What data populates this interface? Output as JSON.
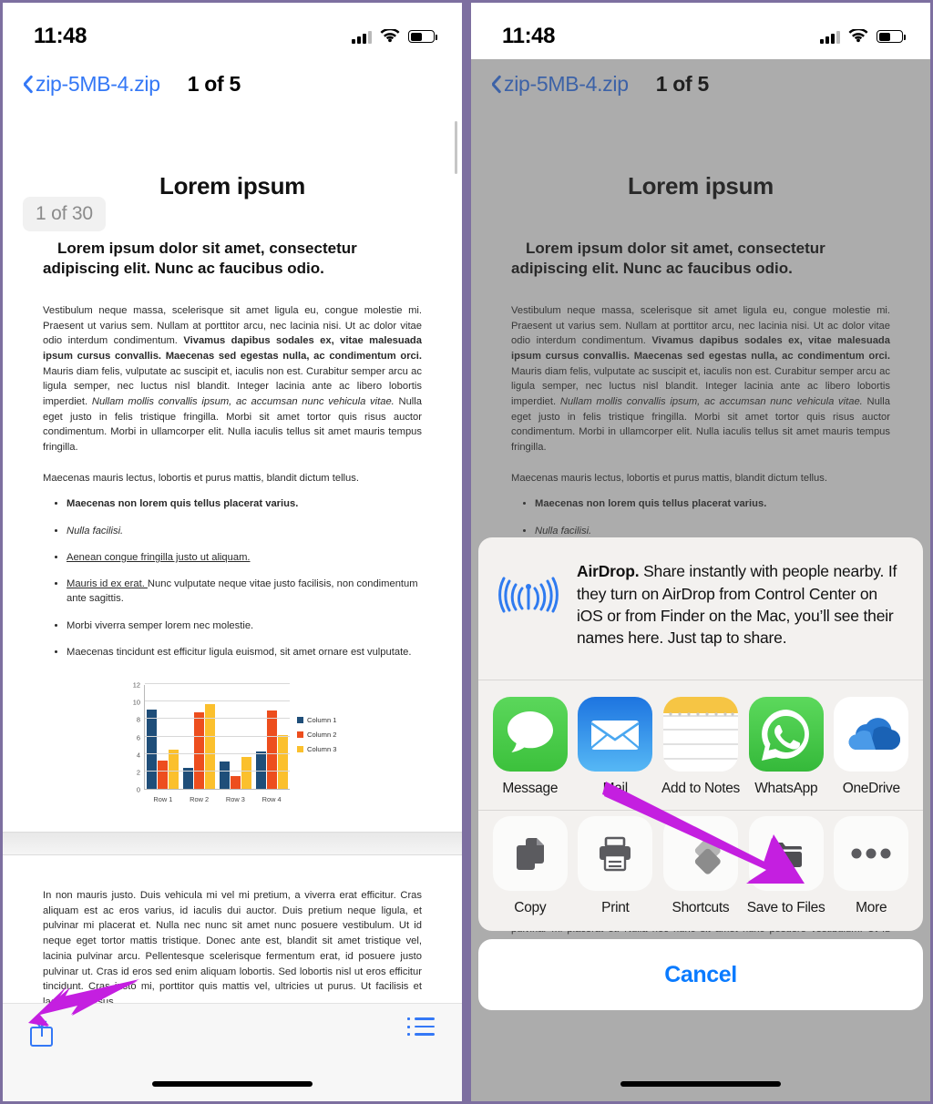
{
  "statusbar": {
    "time": "11:48",
    "cellular_icon": "cellular-bars-icon",
    "wifi_icon": "wifi-icon",
    "battery_icon": "battery-icon"
  },
  "navbar": {
    "back_label": "zip-5MB-4.zip",
    "back_icon": "chevron-left-icon",
    "title": "1 of 5"
  },
  "document": {
    "page_badge": "1 of 30",
    "heading": "Lorem ipsum",
    "subheading": "Lorem ipsum dolor sit amet, consectetur adipiscing elit. Nunc ac faucibus odio.",
    "paragraph_parts": {
      "p1a": "Vestibulum neque massa, scelerisque sit amet ligula eu, congue molestie mi. Praesent ut varius sem. Nullam at porttitor arcu, nec lacinia nisi. Ut ac dolor vitae odio interdum condimentum. ",
      "p1b": "Vivamus dapibus sodales ex, vitae malesuada ipsum cursus convallis. Maecenas sed egestas nulla, ac condimentum orci.",
      "p1c": " Mauris diam felis, vulputate ac suscipit et, iaculis non est. Curabitur semper arcu ac ligula semper, nec luctus nisl blandit. Integer lacinia ante ac libero lobortis imperdiet. ",
      "p1d": "Nullam mollis convallis ipsum, ac accumsan nunc vehicula vitae.",
      "p1e": " Nulla eget justo in felis tristique fringilla. Morbi sit amet tortor quis risus auctor condimentum. Morbi in ullamcorper elit. Nulla iaculis tellus sit amet mauris tempus fringilla."
    },
    "paragraph2": "Maecenas mauris lectus, lobortis et purus mattis, blandit dictum tellus.",
    "bullets": [
      {
        "text": "Maecenas non lorem quis tellus placerat varius.",
        "style": "bold"
      },
      {
        "text": "Nulla facilisi.",
        "style": "italic"
      },
      {
        "text": "Aenean congue fringilla justo ut aliquam. ",
        "style": "underline"
      },
      {
        "lead": "Mauris id ex erat. ",
        "text": "Nunc vulputate neque vitae justo facilisis, non condimentum ante sagittis.",
        "style": "underline-lead"
      },
      {
        "text": "Morbi viverra semper lorem nec molestie.",
        "style": "normal"
      },
      {
        "text": "Maecenas tincidunt est efficitur ligula euismod, sit amet ornare est vulputate.",
        "style": "normal"
      }
    ],
    "page2_paragraph": "In non mauris justo. Duis vehicula mi vel mi pretium, a viverra erat efficitur. Cras aliquam est ac eros varius, id iaculis dui auctor. Duis pretium neque ligula, et pulvinar mi placerat et. Nulla nec nunc sit amet nunc posuere vestibulum. Ut id neque eget tortor mattis tristique. Donec ante est, blandit sit amet tristique vel, lacinia pulvinar arcu. Pellentesque scelerisque fermentum erat, id posuere justo pulvinar ut. Cras id eros sed enim aliquam lobortis. Sed lobortis nisl ut eros efficitur tincidunt. Cras justo mi, porttitor quis mattis vel, ultricies ut purus. Ut facilisis et lacus eu cursus."
  },
  "chart_data": {
    "type": "bar",
    "title": "",
    "xlabel": "",
    "ylabel": "",
    "categories": [
      "Row 1",
      "Row 2",
      "Row 3",
      "Row 4"
    ],
    "series": [
      {
        "name": "Column 1",
        "color": "#1f4e79",
        "values": [
          9.1,
          2.4,
          3.1,
          4.3
        ]
      },
      {
        "name": "Column 2",
        "color": "#ed4e1e",
        "values": [
          3.2,
          8.8,
          1.5,
          9.0
        ]
      },
      {
        "name": "Column 3",
        "color": "#fbc02d",
        "values": [
          4.5,
          9.7,
          3.7,
          6.2
        ]
      }
    ],
    "ylim": [
      0,
      12
    ],
    "yticks": [
      0,
      2,
      4,
      6,
      8,
      10,
      12
    ],
    "grid": true,
    "legend_position": "right"
  },
  "toolbar": {
    "share_icon": "share-icon",
    "list_icon": "list-view-icon"
  },
  "share_sheet": {
    "airdrop_icon": "airdrop-icon",
    "airdrop_title": "AirDrop.",
    "airdrop_text": " Share instantly with people nearby. If they turn on AirDrop from Control Center on iOS or from Finder on the Mac, you’ll see their names here. Just tap to share.",
    "apps": [
      {
        "label": "Message",
        "icon": "messages-app-icon"
      },
      {
        "label": "Mail",
        "icon": "mail-app-icon"
      },
      {
        "label": "Add to Notes",
        "icon": "notes-app-icon"
      },
      {
        "label": "WhatsApp",
        "icon": "whatsapp-app-icon"
      },
      {
        "label": "OneDrive",
        "icon": "onedrive-app-icon"
      }
    ],
    "actions": [
      {
        "label": "Copy",
        "icon": "copy-icon"
      },
      {
        "label": "Print",
        "icon": "printer-icon"
      },
      {
        "label": "Shortcuts",
        "icon": "shortcuts-icon"
      },
      {
        "label": "Save to Files",
        "icon": "folder-icon"
      },
      {
        "label": "More",
        "icon": "ellipsis-icon"
      }
    ],
    "cancel_label": "Cancel"
  },
  "annotations": {
    "arrow_color": "#c41fe0",
    "arrow_left_target": "share-icon",
    "arrow_right_target": "save-to-files-action"
  },
  "colors": {
    "accent_blue": "#3478f6",
    "cancel_blue": "#0a7bff",
    "arrow_purple": "#c41fe0"
  }
}
